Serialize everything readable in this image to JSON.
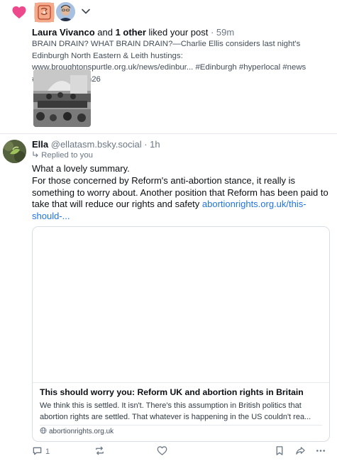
{
  "notification": {
    "icon": "heart-icon",
    "heart_color": "#ec4a8d",
    "user_name": "Laura Vivanco",
    "connector": " and ",
    "others": "1 other",
    "action": " liked your post",
    "separator": " · ",
    "time": "59m",
    "post_text": "BRAIN DRAIN? WHAT BRAIN DRAIN?—Charlie Ellis considers last night's Edinburgh North Eastern & Leith hustings: www.broughtonspurtle.org.uk/news/edinbur... #Edinburgh #hyperlocal #news #scottishelection26"
  },
  "reply": {
    "author_name": "Ella",
    "handle": "@ellatasm.bsky.social",
    "separator": " · ",
    "time": "1h",
    "replied_label": "Replied to you",
    "text_line1": "What a lovely summary.",
    "text_main": "For those concerned by Reform's anti-abortion stance, it really is something to worry about. Another position that Reform has been paid to take that will reduce our rights and safety ",
    "text_link": "abortionrights.org.uk/this-should-...",
    "card": {
      "title": "This should worry you: Reform UK and abortion rights in Britain",
      "description": "We think this is settled. It isn't. There's this assumption in British politics that abortion rights are settled. That whatever is happening in the US couldn't rea...",
      "domain": "abortionrights.org.uk"
    },
    "actions": {
      "reply_count": "1"
    }
  },
  "colors": {
    "accent_link": "#1f73e8",
    "muted": "#6b7785"
  }
}
